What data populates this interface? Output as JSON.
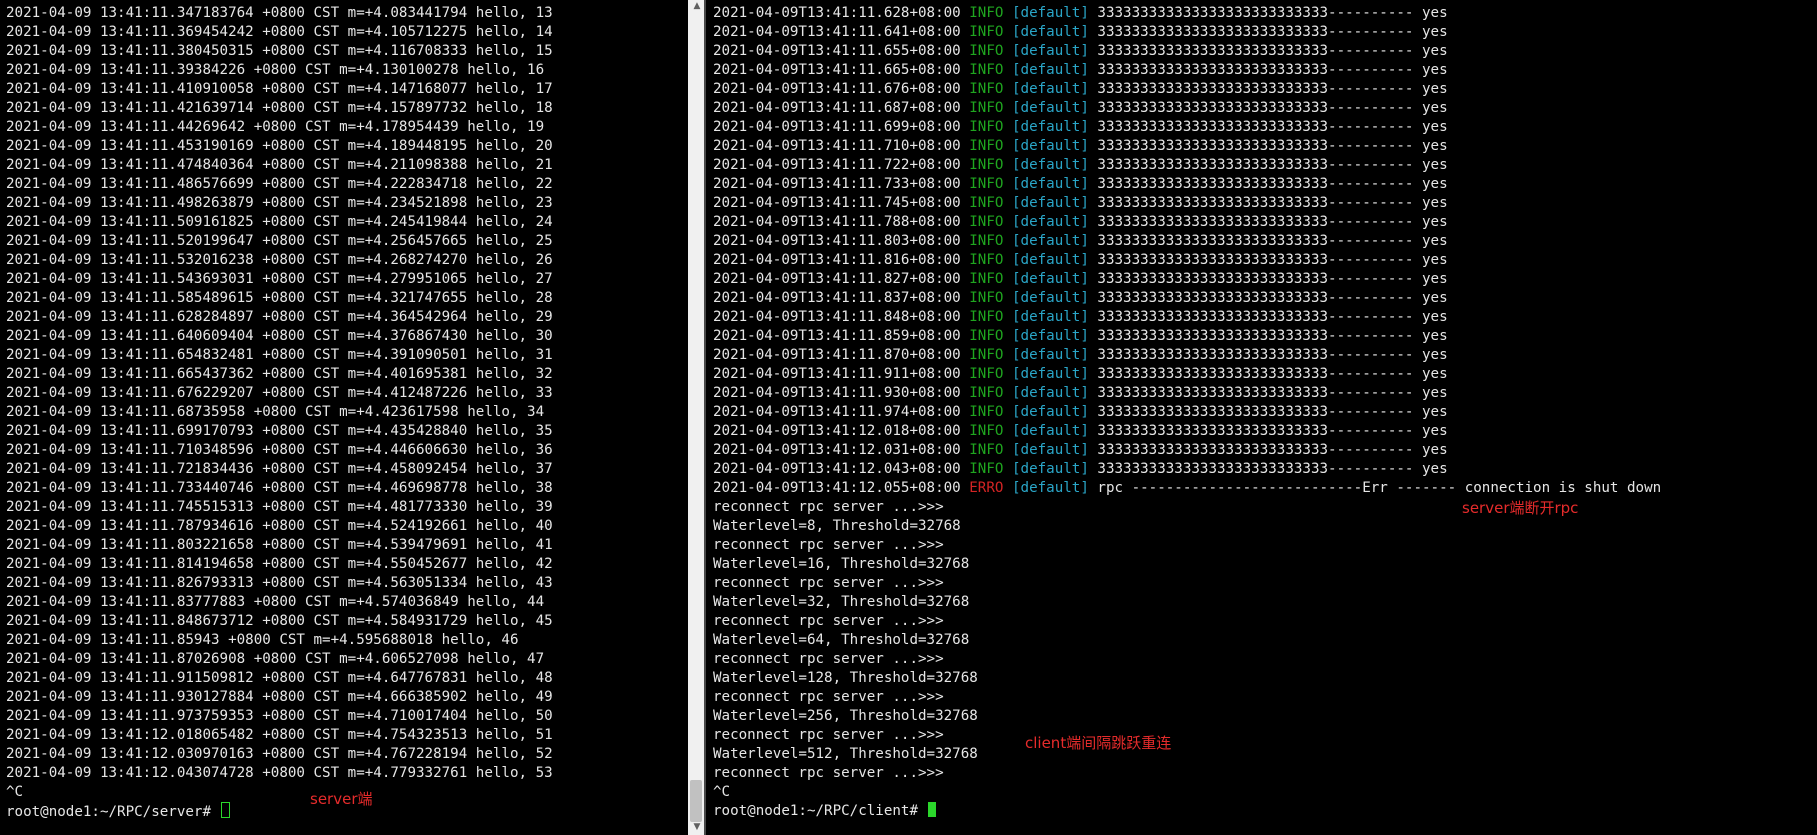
{
  "server_terminal": {
    "lines": [
      "2021-04-09 13:41:11.347183764 +0800 CST m=+4.083441794 hello, 13",
      "2021-04-09 13:41:11.369454242 +0800 CST m=+4.105712275 hello, 14",
      "2021-04-09 13:41:11.380450315 +0800 CST m=+4.116708333 hello, 15",
      "2021-04-09 13:41:11.39384226 +0800 CST m=+4.130100278 hello, 16",
      "2021-04-09 13:41:11.410910058 +0800 CST m=+4.147168077 hello, 17",
      "2021-04-09 13:41:11.421639714 +0800 CST m=+4.157897732 hello, 18",
      "2021-04-09 13:41:11.44269642 +0800 CST m=+4.178954439 hello, 19",
      "2021-04-09 13:41:11.453190169 +0800 CST m=+4.189448195 hello, 20",
      "2021-04-09 13:41:11.474840364 +0800 CST m=+4.211098388 hello, 21",
      "2021-04-09 13:41:11.486576699 +0800 CST m=+4.222834718 hello, 22",
      "2021-04-09 13:41:11.498263879 +0800 CST m=+4.234521898 hello, 23",
      "2021-04-09 13:41:11.509161825 +0800 CST m=+4.245419844 hello, 24",
      "2021-04-09 13:41:11.520199647 +0800 CST m=+4.256457665 hello, 25",
      "2021-04-09 13:41:11.532016238 +0800 CST m=+4.268274270 hello, 26",
      "2021-04-09 13:41:11.543693031 +0800 CST m=+4.279951065 hello, 27",
      "2021-04-09 13:41:11.585489615 +0800 CST m=+4.321747655 hello, 28",
      "2021-04-09 13:41:11.628284897 +0800 CST m=+4.364542964 hello, 29",
      "2021-04-09 13:41:11.640609404 +0800 CST m=+4.376867430 hello, 30",
      "2021-04-09 13:41:11.654832481 +0800 CST m=+4.391090501 hello, 31",
      "2021-04-09 13:41:11.665437362 +0800 CST m=+4.401695381 hello, 32",
      "2021-04-09 13:41:11.676229207 +0800 CST m=+4.412487226 hello, 33",
      "2021-04-09 13:41:11.68735958 +0800 CST m=+4.423617598 hello, 34",
      "2021-04-09 13:41:11.699170793 +0800 CST m=+4.435428840 hello, 35",
      "2021-04-09 13:41:11.710348596 +0800 CST m=+4.446606630 hello, 36",
      "2021-04-09 13:41:11.721834436 +0800 CST m=+4.458092454 hello, 37",
      "2021-04-09 13:41:11.733440746 +0800 CST m=+4.469698778 hello, 38",
      "2021-04-09 13:41:11.745515313 +0800 CST m=+4.481773330 hello, 39",
      "2021-04-09 13:41:11.787934616 +0800 CST m=+4.524192661 hello, 40",
      "2021-04-09 13:41:11.803221658 +0800 CST m=+4.539479691 hello, 41",
      "2021-04-09 13:41:11.814194658 +0800 CST m=+4.550452677 hello, 42",
      "2021-04-09 13:41:11.826793313 +0800 CST m=+4.563051334 hello, 43",
      "2021-04-09 13:41:11.83777883 +0800 CST m=+4.574036849 hello, 44",
      "2021-04-09 13:41:11.848673712 +0800 CST m=+4.584931729 hello, 45",
      "2021-04-09 13:41:11.85943 +0800 CST m=+4.595688018 hello, 46",
      "2021-04-09 13:41:11.87026908 +0800 CST m=+4.606527098 hello, 47",
      "2021-04-09 13:41:11.911509812 +0800 CST m=+4.647767831 hello, 48",
      "2021-04-09 13:41:11.930127884 +0800 CST m=+4.666385902 hello, 49",
      "2021-04-09 13:41:11.973759353 +0800 CST m=+4.710017404 hello, 50",
      "2021-04-09 13:41:12.018065482 +0800 CST m=+4.754323513 hello, 51",
      "2021-04-09 13:41:12.030970163 +0800 CST m=+4.767228194 hello, 52",
      "2021-04-09 13:41:12.043074728 +0800 CST m=+4.779332761 hello, 53",
      "^C"
    ],
    "prompt": "root@node1:~/RPC/server# "
  },
  "client_terminal": {
    "log_lines": [
      {
        "ts": "2021-04-09T13:41:11.628+08:00",
        "level": "INFO",
        "tag": "[default]",
        "msg": "333333333333333333333333333---------- yes"
      },
      {
        "ts": "2021-04-09T13:41:11.641+08:00",
        "level": "INFO",
        "tag": "[default]",
        "msg": "333333333333333333333333333---------- yes"
      },
      {
        "ts": "2021-04-09T13:41:11.655+08:00",
        "level": "INFO",
        "tag": "[default]",
        "msg": "333333333333333333333333333---------- yes"
      },
      {
        "ts": "2021-04-09T13:41:11.665+08:00",
        "level": "INFO",
        "tag": "[default]",
        "msg": "333333333333333333333333333---------- yes"
      },
      {
        "ts": "2021-04-09T13:41:11.676+08:00",
        "level": "INFO",
        "tag": "[default]",
        "msg": "333333333333333333333333333---------- yes"
      },
      {
        "ts": "2021-04-09T13:41:11.687+08:00",
        "level": "INFO",
        "tag": "[default]",
        "msg": "333333333333333333333333333---------- yes"
      },
      {
        "ts": "2021-04-09T13:41:11.699+08:00",
        "level": "INFO",
        "tag": "[default]",
        "msg": "333333333333333333333333333---------- yes"
      },
      {
        "ts": "2021-04-09T13:41:11.710+08:00",
        "level": "INFO",
        "tag": "[default]",
        "msg": "333333333333333333333333333---------- yes"
      },
      {
        "ts": "2021-04-09T13:41:11.722+08:00",
        "level": "INFO",
        "tag": "[default]",
        "msg": "333333333333333333333333333---------- yes"
      },
      {
        "ts": "2021-04-09T13:41:11.733+08:00",
        "level": "INFO",
        "tag": "[default]",
        "msg": "333333333333333333333333333---------- yes"
      },
      {
        "ts": "2021-04-09T13:41:11.745+08:00",
        "level": "INFO",
        "tag": "[default]",
        "msg": "333333333333333333333333333---------- yes"
      },
      {
        "ts": "2021-04-09T13:41:11.788+08:00",
        "level": "INFO",
        "tag": "[default]",
        "msg": "333333333333333333333333333---------- yes"
      },
      {
        "ts": "2021-04-09T13:41:11.803+08:00",
        "level": "INFO",
        "tag": "[default]",
        "msg": "333333333333333333333333333---------- yes"
      },
      {
        "ts": "2021-04-09T13:41:11.816+08:00",
        "level": "INFO",
        "tag": "[default]",
        "msg": "333333333333333333333333333---------- yes"
      },
      {
        "ts": "2021-04-09T13:41:11.827+08:00",
        "level": "INFO",
        "tag": "[default]",
        "msg": "333333333333333333333333333---------- yes"
      },
      {
        "ts": "2021-04-09T13:41:11.837+08:00",
        "level": "INFO",
        "tag": "[default]",
        "msg": "333333333333333333333333333---------- yes"
      },
      {
        "ts": "2021-04-09T13:41:11.848+08:00",
        "level": "INFO",
        "tag": "[default]",
        "msg": "333333333333333333333333333---------- yes"
      },
      {
        "ts": "2021-04-09T13:41:11.859+08:00",
        "level": "INFO",
        "tag": "[default]",
        "msg": "333333333333333333333333333---------- yes"
      },
      {
        "ts": "2021-04-09T13:41:11.870+08:00",
        "level": "INFO",
        "tag": "[default]",
        "msg": "333333333333333333333333333---------- yes"
      },
      {
        "ts": "2021-04-09T13:41:11.911+08:00",
        "level": "INFO",
        "tag": "[default]",
        "msg": "333333333333333333333333333---------- yes"
      },
      {
        "ts": "2021-04-09T13:41:11.930+08:00",
        "level": "INFO",
        "tag": "[default]",
        "msg": "333333333333333333333333333---------- yes"
      },
      {
        "ts": "2021-04-09T13:41:11.974+08:00",
        "level": "INFO",
        "tag": "[default]",
        "msg": "333333333333333333333333333---------- yes"
      },
      {
        "ts": "2021-04-09T13:41:12.018+08:00",
        "level": "INFO",
        "tag": "[default]",
        "msg": "333333333333333333333333333---------- yes"
      },
      {
        "ts": "2021-04-09T13:41:12.031+08:00",
        "level": "INFO",
        "tag": "[default]",
        "msg": "333333333333333333333333333---------- yes"
      },
      {
        "ts": "2021-04-09T13:41:12.043+08:00",
        "level": "INFO",
        "tag": "[default]",
        "msg": "333333333333333333333333333---------- yes"
      },
      {
        "ts": "2021-04-09T13:41:12.055+08:00",
        "level": "ERRO",
        "tag": "[default]",
        "msg": "rpc ---------------------------Err ------- connection is shut down"
      }
    ],
    "plain_lines": [
      "reconnect rpc server ...>>>",
      "Waterlevel=8, Threshold=32768",
      "reconnect rpc server ...>>>",
      "Waterlevel=16, Threshold=32768",
      "reconnect rpc server ...>>>",
      "Waterlevel=32, Threshold=32768",
      "reconnect rpc server ...>>>",
      "Waterlevel=64, Threshold=32768",
      "reconnect rpc server ...>>>",
      "Waterlevel=128, Threshold=32768",
      "reconnect rpc server ...>>>",
      "Waterlevel=256, Threshold=32768",
      "reconnect rpc server ...>>>",
      "Waterlevel=512, Threshold=32768",
      "reconnect rpc server ...>>>",
      "^C"
    ],
    "prompt": "root@node1:~/RPC/client# "
  },
  "annotations": {
    "server_label": "server端",
    "server_disconnect": "server端断开rpc",
    "client_reconnect": "client端间隔跳跃重连"
  },
  "colors": {
    "background": "#000000",
    "text": "#e6e6e6",
    "info": "#1fa51f",
    "error": "#d42424",
    "tag": "#2aa6c8",
    "cursor": "#2bd62b",
    "annotation": "#e52b2b"
  },
  "scrollbar": {
    "up_arrow": "▲",
    "down_arrow": "▼"
  }
}
